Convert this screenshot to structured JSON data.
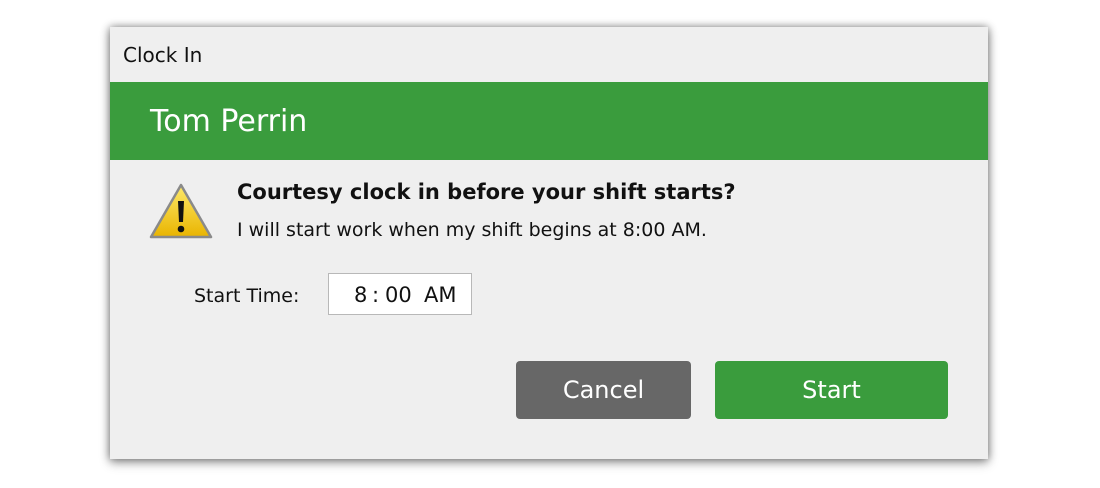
{
  "window": {
    "title": "Clock In"
  },
  "banner": {
    "employee_name": "Tom Perrin",
    "color": "#3a9c3d"
  },
  "message": {
    "icon": "warning-icon",
    "heading": "Courtesy clock in before your shift starts?",
    "body": "I will start work when my shift begins at 8:00 AM."
  },
  "start_time": {
    "label": "Start Time:",
    "hour": "8",
    "separator": ":",
    "minute": "00",
    "period": "AM"
  },
  "buttons": {
    "cancel_label": "Cancel",
    "start_label": "Start",
    "cancel_color": "#676767",
    "start_color": "#3a9c3d"
  }
}
